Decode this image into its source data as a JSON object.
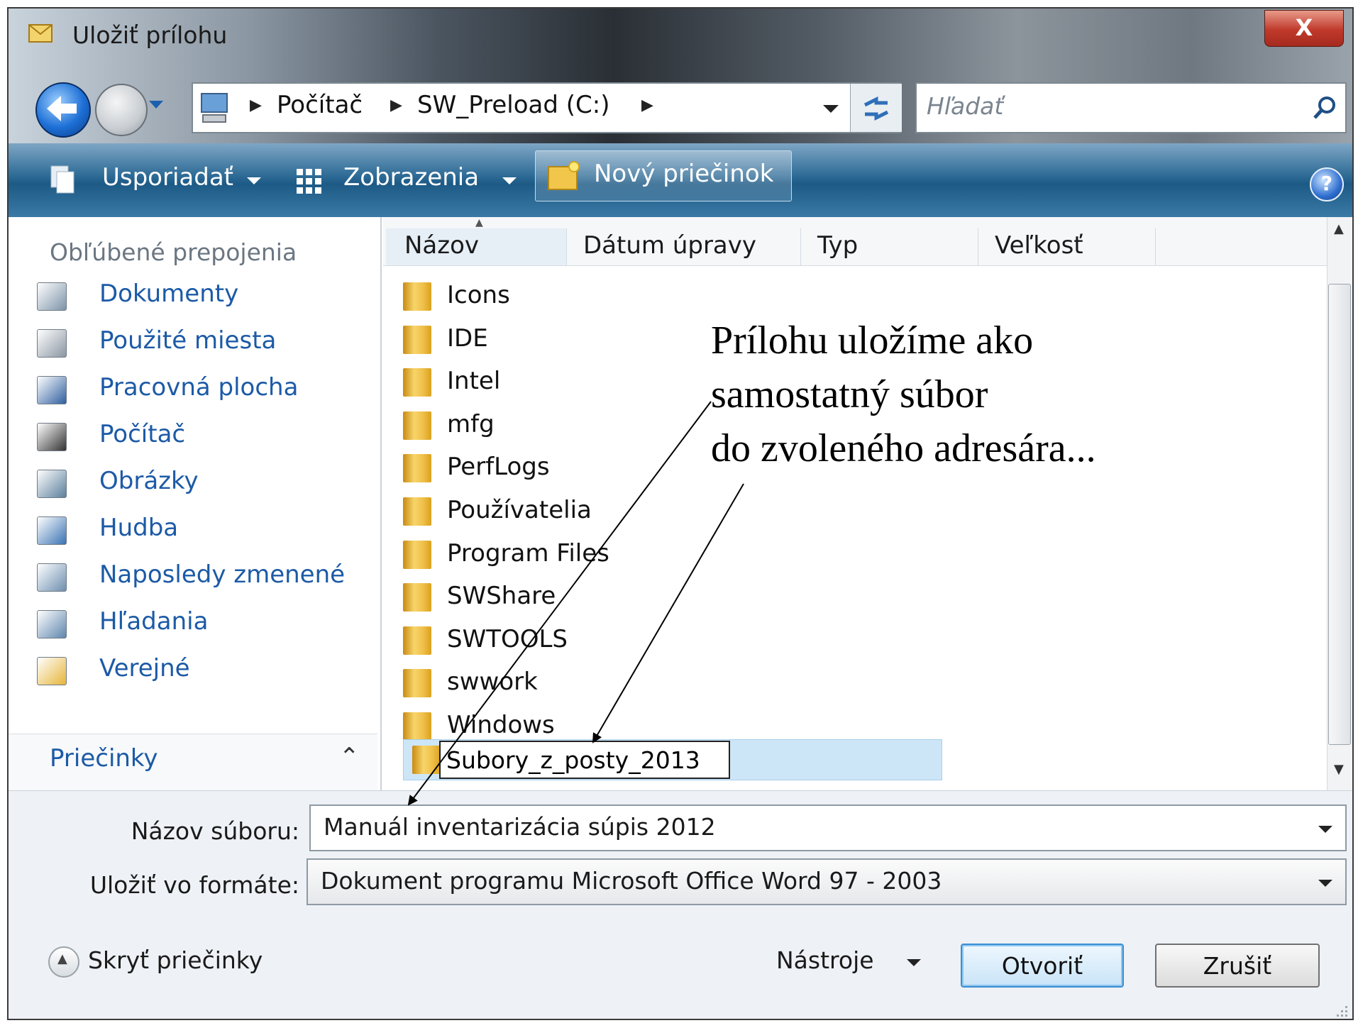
{
  "window": {
    "title": "Uložiť prílohu",
    "close_label": "X"
  },
  "address_bar": {
    "segments": [
      "Počítač",
      "SW_Preload (C:)"
    ],
    "search_placeholder": "Hľadať"
  },
  "toolbar": {
    "organize_label": "Usporiadať",
    "views_label": "Zobrazenia",
    "new_folder_label": "Nový priečinok",
    "help_label": "?"
  },
  "favorites": {
    "heading": "Obľúbené prepojenia",
    "items": [
      {
        "label": "Dokumenty",
        "icon": "documents-icon"
      },
      {
        "label": "Použité miesta",
        "icon": "recent-places-icon"
      },
      {
        "label": "Pracovná plocha",
        "icon": "desktop-icon"
      },
      {
        "label": "Počítač",
        "icon": "computer-icon"
      },
      {
        "label": "Obrázky",
        "icon": "pictures-icon"
      },
      {
        "label": "Hudba",
        "icon": "music-icon"
      },
      {
        "label": "Naposledy zmenené",
        "icon": "recently-changed-icon"
      },
      {
        "label": "Hľadania",
        "icon": "searches-icon"
      },
      {
        "label": "Verejné",
        "icon": "public-folder-icon"
      }
    ],
    "folders_label": "Priečinky"
  },
  "columns": [
    "Názov",
    "Dátum úpravy",
    "Typ",
    "Veľkosť"
  ],
  "files": [
    "Icons",
    "IDE",
    "Intel",
    "mfg",
    "PerfLogs",
    "Používatelia",
    "Program Files",
    "SWShare",
    "SWTOOLS",
    "swwork",
    "Windows"
  ],
  "new_folder_name": "Subory_z_posty_2013",
  "form": {
    "filename_label": "Názov súboru:",
    "filename_value": "Manuál inventarizácia súpis 2012",
    "format_label": "Uložiť vo formáte:",
    "format_value": "Dokument programu Microsoft Office Word 97 - 2003"
  },
  "footer": {
    "hide_folders_label": "Skryť priečinky",
    "tools_label": "Nástroje",
    "open_label": "Otvoriť",
    "cancel_label": "Zrušiť"
  },
  "annotation": {
    "lines": [
      "Prílohu uložíme ako",
      "samostatný súbor",
      "do zvoleného adresára..."
    ]
  },
  "colors": {
    "link_blue": "#1c5aa6",
    "toolbar_blue": "#1d5a86",
    "selection": "#cde6f7"
  }
}
